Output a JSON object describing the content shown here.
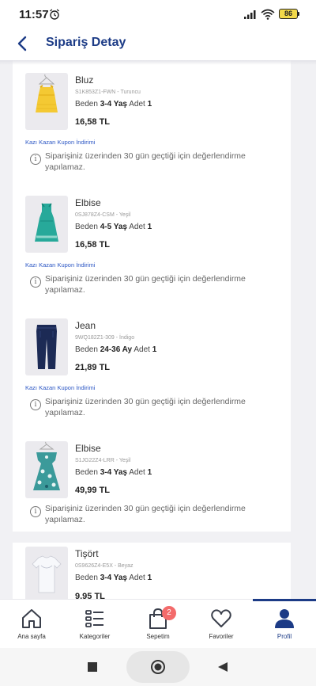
{
  "status": {
    "time": "11:57",
    "battery": "86"
  },
  "header": {
    "title": "Sipariş Detay"
  },
  "colors": {
    "brand": "#1c3b86",
    "link": "#2b56c4",
    "badge": "#f36b6b",
    "background": "#f1f1f4"
  },
  "items": [
    {
      "name": "Bluz",
      "code": "S1K853Z1-FWN - Turuncu",
      "size_label": "Beden",
      "size": "3-4 Yaş",
      "qty_label": "Adet",
      "qty": "1",
      "price": "16,58 TL",
      "coupon": "Kazı Kazan Kupon İndirimi",
      "info": "Siparişiniz üzerinden 30 gün geçtiği için değerlendirme yapılamaz.",
      "image": "yellow-blouse"
    },
    {
      "name": "Elbise",
      "code": "0SJ878Z4-CSM - Yeşil",
      "size_label": "Beden",
      "size": "4-5 Yaş",
      "qty_label": "Adet",
      "qty": "1",
      "price": "16,58 TL",
      "coupon": "Kazı Kazan Kupon İndirimi",
      "info": "Siparişiniz üzerinden 30 gün geçtiği için değerlendirme yapılamaz.",
      "image": "green-dress"
    },
    {
      "name": "Jean",
      "code": "9WQ182Z1-309 - İndigo",
      "size_label": "Beden",
      "size": "24-36 Ay",
      "qty_label": "Adet",
      "qty": "1",
      "price": "21,89 TL",
      "coupon": "Kazı Kazan Kupon İndirimi",
      "info": "Siparişiniz üzerinden 30 gün geçtiği için değerlendirme yapılamaz.",
      "image": "denim-jeans"
    },
    {
      "name": "Elbise",
      "code": "S1JG22Z4-LRR - Yeşil",
      "size_label": "Beden",
      "size": "3-4 Yaş",
      "qty_label": "Adet",
      "qty": "1",
      "price": "49,99 TL",
      "coupon": "",
      "info": "Siparişiniz üzerinden 30 gün geçtiği için değerlendirme yapılamaz.",
      "image": "floral-dress"
    },
    {
      "name": "Tişört",
      "code": "0S9626Z4-E5X - Beyaz",
      "size_label": "Beden",
      "size": "3-4 Yaş",
      "qty_label": "Adet",
      "qty": "1",
      "price": "9,95 TL",
      "coupon": "",
      "info": "",
      "image": "white-tshirt"
    }
  ],
  "bottom_nav": {
    "home": "Ana sayfa",
    "categories": "Kategoriler",
    "cart": "Sepetim",
    "cart_badge": "2",
    "favorites": "Favoriler",
    "profile": "Profil"
  }
}
